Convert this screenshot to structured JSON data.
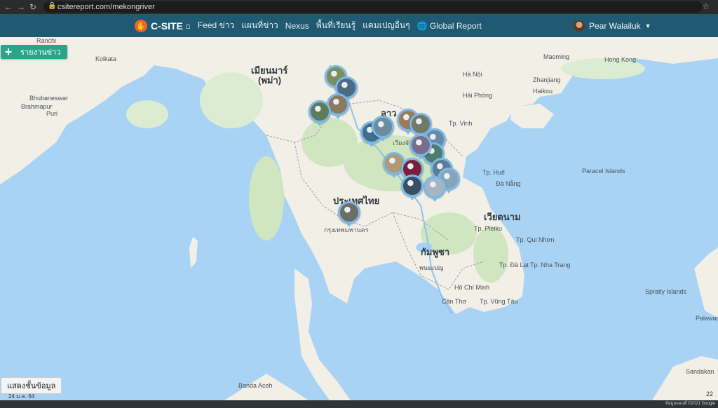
{
  "browser": {
    "url": "csitereport.com/mekongriver"
  },
  "nav": {
    "brand": "C-SITE",
    "items": [
      "Feed ข่าว",
      "แผนที่ข่าว",
      "Nexus",
      "พื้นที่เรียนรู้",
      "แคมเปญอื่นๆ",
      "Global Report"
    ],
    "user": "Pear Walailuk"
  },
  "actions": {
    "add_report": "รายงานข่าว",
    "show_data": "แสดงชั้นข้อมูล"
  },
  "footer": {
    "date": "24 ม.ค. 64",
    "zoom": "22",
    "attribution": "ข้อมูลแผนที่ ©2021 Google"
  },
  "map": {
    "colors": {
      "water": "#a9d3f5",
      "land": "#f2efe6",
      "forest": "#cfe6c1",
      "marker_border": "#7cb8e6"
    },
    "labels": [
      {
        "key": "l1",
        "text": "เมียนมาร์",
        "kind": "country"
      },
      {
        "key": "l2",
        "text": "(พม่า)",
        "kind": "country"
      },
      {
        "key": "l3",
        "text": "ลาว",
        "kind": "country"
      },
      {
        "key": "l4",
        "text": "ประเทศไทย",
        "kind": "country"
      },
      {
        "key": "l5",
        "text": "เวียดนาม",
        "kind": "country"
      },
      {
        "key": "l6",
        "text": "กัมพูชา",
        "kind": "country"
      },
      {
        "key": "l7",
        "text": "Hong Kong",
        "kind": "city"
      },
      {
        "key": "l8",
        "text": "Hà Nội",
        "kind": "city"
      },
      {
        "key": "l9",
        "text": "Hải Phòng",
        "kind": "city"
      },
      {
        "key": "l10",
        "text": "Hồ Chí Minh",
        "kind": "city"
      },
      {
        "key": "l11",
        "text": "Kolkata",
        "kind": "city"
      },
      {
        "key": "l12",
        "text": "Bhubaneswar",
        "kind": "city"
      },
      {
        "key": "l13",
        "text": "Ranchi",
        "kind": "city"
      },
      {
        "key": "l14",
        "text": "กรุงเทพมหานคร",
        "kind": "city"
      },
      {
        "key": "l15",
        "text": "พนมเปญ",
        "kind": "city"
      },
      {
        "key": "l16",
        "text": "เวียงจันทน์",
        "kind": "city"
      },
      {
        "key": "l17",
        "text": "Tp. Huế",
        "kind": "city"
      },
      {
        "key": "l18",
        "text": "Đà Nẵng",
        "kind": "city"
      },
      {
        "key": "l19",
        "text": "Paracel Islands",
        "kind": "city"
      },
      {
        "key": "l20",
        "text": "Spratly Islands",
        "kind": "city"
      },
      {
        "key": "l21",
        "text": "Banda Aceh",
        "kind": "city"
      },
      {
        "key": "l22",
        "text": "Sandakan",
        "kind": "city"
      },
      {
        "key": "l23",
        "text": "Palawan",
        "kind": "city"
      },
      {
        "key": "l24",
        "text": "Tp. Nha Trang",
        "kind": "city"
      },
      {
        "key": "l25",
        "text": "Tp. Vũng Tàu",
        "kind": "city"
      },
      {
        "key": "l26",
        "text": "Cần Thơ",
        "kind": "city"
      },
      {
        "key": "l27",
        "text": "Haikou",
        "kind": "city"
      },
      {
        "key": "l28",
        "text": "Zhanjiang",
        "kind": "city"
      },
      {
        "key": "l29",
        "text": "Maoming",
        "kind": "city"
      },
      {
        "key": "l30",
        "text": "Tp. Vinh",
        "kind": "city"
      },
      {
        "key": "l31",
        "text": "Tp. Pleiku",
        "kind": "city"
      },
      {
        "key": "l32",
        "text": "Tp. Qui Nhơn",
        "kind": "city"
      },
      {
        "key": "l33",
        "text": "Tp. Đà Lạt",
        "kind": "city"
      },
      {
        "key": "l34",
        "text": "Puri",
        "kind": "city"
      },
      {
        "key": "l35",
        "text": "Brahmapur",
        "kind": "city"
      }
    ],
    "markers": [
      {
        "id": "m1",
        "color": "#7a8f5e"
      },
      {
        "id": "m2",
        "color": "#4b6c84"
      },
      {
        "id": "m3",
        "color": "#8c7a60"
      },
      {
        "id": "m4",
        "color": "#5b7d5a"
      },
      {
        "id": "m5",
        "color": "#3f6f8f"
      },
      {
        "id": "m6",
        "color": "#6a8c9c"
      },
      {
        "id": "m7",
        "color": "#9a7c5a"
      },
      {
        "id": "m8",
        "color": "#6f7b66"
      },
      {
        "id": "m9",
        "color": "#6b8aa8"
      },
      {
        "id": "m10",
        "color": "#4d7e6e"
      },
      {
        "id": "m11",
        "color": "#b09a74"
      },
      {
        "id": "m12",
        "color": "#7b1f3a"
      },
      {
        "id": "m13",
        "color": "#3b4e63"
      },
      {
        "id": "m14",
        "color": "#5d7d95"
      },
      {
        "id": "m15",
        "color": "#8aa3b8"
      },
      {
        "id": "m16",
        "color": "#a7b5c0"
      },
      {
        "id": "m17",
        "color": "#6c6e66"
      },
      {
        "id": "m18",
        "color": "#7a6e8c"
      }
    ]
  }
}
